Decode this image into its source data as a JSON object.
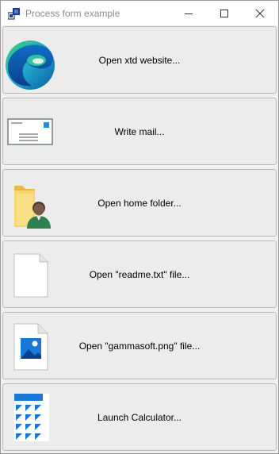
{
  "window": {
    "title": "Process form example",
    "icon": "app-window-icon",
    "controls": [
      "minimize-icon",
      "maximize-icon",
      "close-icon"
    ]
  },
  "buttons": [
    {
      "label": "Open xtd website...",
      "icon": "edge-browser-icon"
    },
    {
      "label": "Write mail...",
      "icon": "mail-envelope-icon"
    },
    {
      "label": "Open home folder...",
      "icon": "user-folder-icon"
    },
    {
      "label": "Open \"readme.txt\" file...",
      "icon": "text-document-icon"
    },
    {
      "label": "Open \"gammasoft.png\" file...",
      "icon": "image-file-icon"
    },
    {
      "label": "Launch Calculator...",
      "icon": "calculator-icon"
    }
  ]
}
